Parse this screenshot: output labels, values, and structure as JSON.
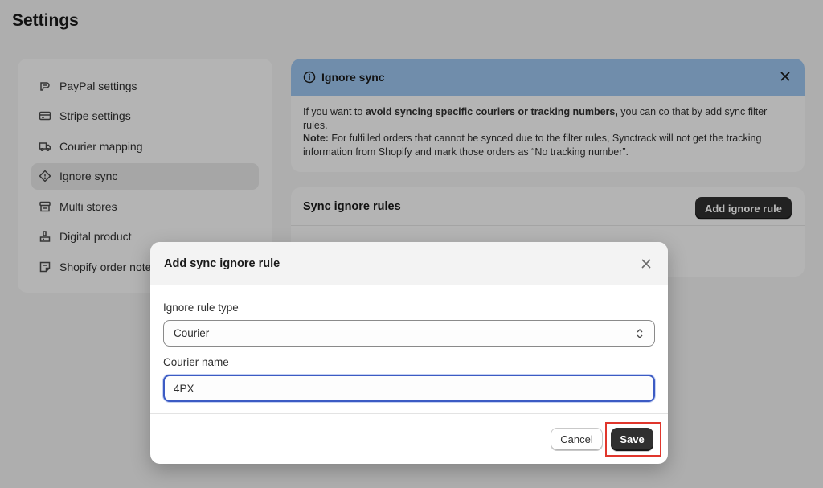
{
  "page": {
    "title": "Settings"
  },
  "sidebar": {
    "items": [
      {
        "label": "PayPal settings",
        "icon": "paypal-icon",
        "active": false
      },
      {
        "label": "Stripe settings",
        "icon": "credit-card-icon",
        "active": false
      },
      {
        "label": "Courier mapping",
        "icon": "truck-icon",
        "active": false
      },
      {
        "label": "Ignore sync",
        "icon": "diamond-alert-icon",
        "active": true
      },
      {
        "label": "Multi stores",
        "icon": "store-icon",
        "active": false
      },
      {
        "label": "Digital product",
        "icon": "digital-product-icon",
        "active": false
      },
      {
        "label": "Shopify order notes",
        "icon": "note-icon",
        "active": false
      }
    ]
  },
  "banner": {
    "title": "Ignore sync",
    "line1_pre": "If you want to ",
    "line1_bold": "avoid syncing specific couriers or tracking numbers,",
    "line1_post": "  you can co that by add sync filter rules.",
    "note_label": "Note:",
    "note_text": " For fulfilled orders that cannot be synced due to the filter rules, Synctrack will not get the tracking information from Shopify and mark those orders as “No tracking number”."
  },
  "rules": {
    "title": "Sync ignore rules",
    "add_button": "Add ignore rule"
  },
  "modal": {
    "title": "Add sync ignore rule",
    "rule_type_label": "Ignore rule type",
    "rule_type_value": "Courier",
    "courier_label": "Courier name",
    "courier_value": "4PX",
    "cancel_label": "Cancel",
    "save_label": "Save"
  },
  "colors": {
    "banner_header": "#9cc4ee",
    "primary_button": "#303030",
    "focus_border": "#3c5bc4",
    "highlight": "#e0362c"
  }
}
